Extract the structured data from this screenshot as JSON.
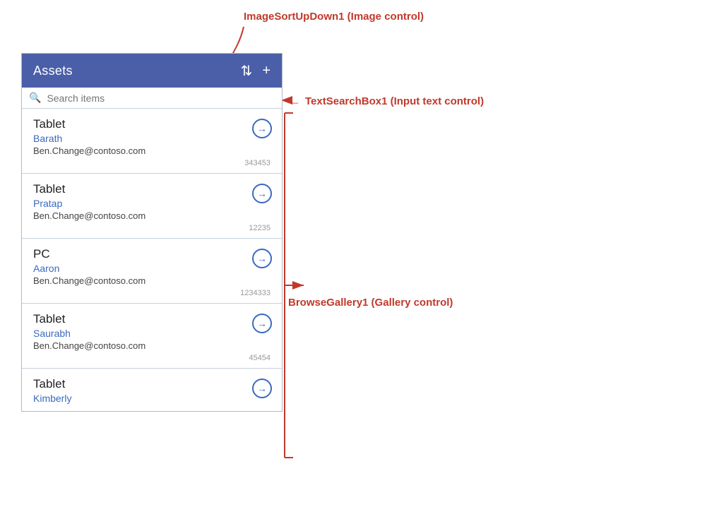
{
  "header": {
    "title": "Assets",
    "sort_icon": "⇅",
    "add_icon": "+"
  },
  "search": {
    "placeholder": "Search items"
  },
  "items": [
    {
      "type": "Tablet",
      "name": "Barath",
      "email": "Ben.Change@contoso.com",
      "id": "343453"
    },
    {
      "type": "Tablet",
      "name": "Pratap",
      "email": "Ben.Change@contoso.com",
      "id": "12235"
    },
    {
      "type": "PC",
      "name": "Aaron",
      "email": "Ben.Change@contoso.com",
      "id": "1234333"
    },
    {
      "type": "Tablet",
      "name": "Saurabh",
      "email": "Ben.Change@contoso.com",
      "id": "45454"
    },
    {
      "type": "Tablet",
      "name": "Kimberly",
      "email": "",
      "id": ""
    }
  ],
  "annotations": {
    "top_label": "ImageSortUpDown1 (Image control)",
    "search_label": "TextSearchBox1 (Input text control)",
    "gallery_label": "BrowseGallery1 (Gallery control)"
  }
}
